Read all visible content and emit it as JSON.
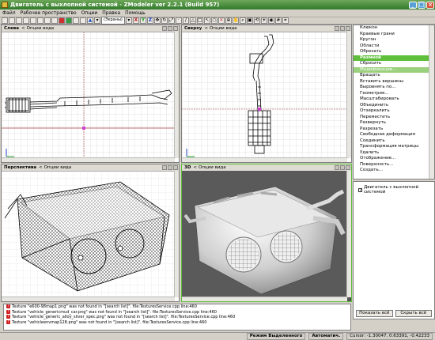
{
  "window": {
    "title": "Двигатель с выхлопной системой - ZModeler ver 2.2.1 (Build 957)"
  },
  "menu": [
    "Файл",
    "Рабочее пространство",
    "Опции",
    "Правка",
    "Помощь"
  ],
  "toolbar": {
    "display_select": "(Экраны)"
  },
  "viewports": [
    {
      "name": "Слева",
      "option": "Опции вида"
    },
    {
      "name": "Сверху",
      "option": "Опции вида"
    },
    {
      "name": "Перспектива",
      "option": "Опции вида"
    },
    {
      "name": "3D",
      "option": "Опции вида"
    }
  ],
  "commands": [
    "Клюкон",
    "Краевые грани",
    "Кругон",
    "Области",
    "Обрезать",
    "Размной",
    "Сбросить",
    "Модификации...",
    "Вращать",
    "Вставить вершины",
    "Выровнять по...",
    "Геометрия...",
    "Масштабировать",
    "Объединить",
    "Отзеркалить",
    "Переместить",
    "Развернуть",
    "Разрезать",
    "Свободная деформация",
    "Соединить",
    "Трансформация матрицы",
    "Удалить",
    "Отображение...",
    "Поверхность...",
    "Создать..."
  ],
  "scene_tree": {
    "node": "Двигатель с выхлопной системой",
    "checked": "✓"
  },
  "buttons": {
    "show_all": "Показать всё",
    "hide_all": "Скрыть всё"
  },
  "log": [
    "Texture \"e600-98map1.png\" was not found in \"[search list]\". file:TexturesService.cpp line:460",
    "Texture \"vehicle_genericmud_car.png\" was not found in \"[search list]\". file:TexturesService.cpp line:460",
    "Texture \"vehicle_generic_alloy_silver_spec.png\" was not found in \"[search list]\". file:TexturesService.cpp line:460",
    "Texture \"vehicleenvmap128.png\" was not found in \"[search list]\". file:TexturesService.cpp line:460"
  ],
  "status": {
    "mode": "Режим Выделенного",
    "auto": "Автоматич.",
    "cursor": "Cursor: -1.30047, 0.63391, -0.42233"
  },
  "colors": {
    "title_bar": "#3e8a35",
    "selected": "#5fbf3a",
    "grid": "#c8c8c8"
  }
}
